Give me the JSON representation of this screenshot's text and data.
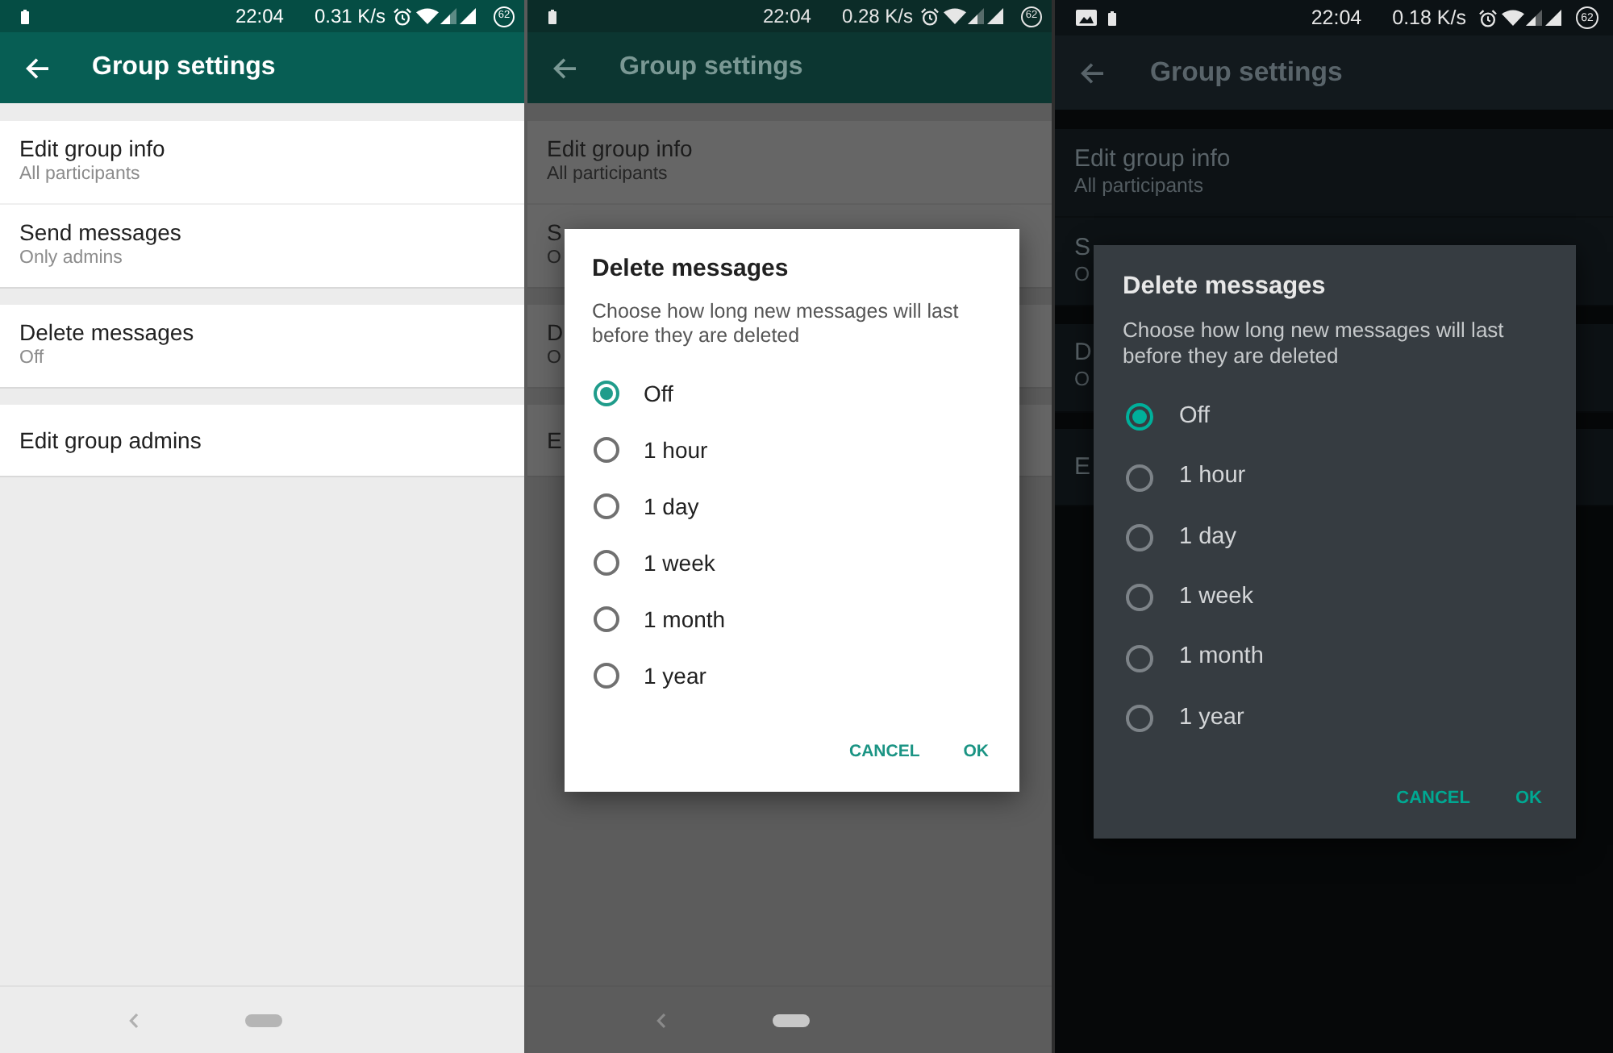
{
  "panels": [
    {
      "kind": "light",
      "status_bar": {
        "time": "22:04",
        "speed": "0.31 K/s",
        "battery": "62"
      },
      "app_bar": {
        "title": "Group settings"
      },
      "sections": [
        {
          "items": [
            {
              "title": "Edit group info",
              "subtitle": "All participants"
            },
            {
              "title": "Send messages",
              "subtitle": "Only admins"
            }
          ]
        },
        {
          "items": [
            {
              "title": "Delete messages",
              "subtitle": "Off"
            }
          ]
        },
        {
          "items": [
            {
              "title": "Edit group admins"
            }
          ]
        }
      ],
      "nav_bar": true
    },
    {
      "kind": "dimmed",
      "status_bar": {
        "time": "22:04",
        "speed": "0.28 K/s",
        "battery": "62"
      },
      "app_bar": {
        "title": "Group settings"
      },
      "sections": [
        {
          "items": [
            {
              "title": "Edit group info",
              "subtitle": "All participants"
            },
            {
              "title": "S",
              "subtitle": "O"
            }
          ]
        },
        {
          "items": [
            {
              "title": "D",
              "subtitle": "O"
            }
          ]
        },
        {
          "items": [
            {
              "title": "E"
            }
          ]
        }
      ],
      "nav_bar": true,
      "dialog": {
        "title": "Delete messages",
        "message": "Choose how long new messages will last before they are deleted",
        "options": [
          {
            "label": "Off",
            "selected": true
          },
          {
            "label": "1 hour",
            "selected": false
          },
          {
            "label": "1 day",
            "selected": false
          },
          {
            "label": "1 week",
            "selected": false
          },
          {
            "label": "1 month",
            "selected": false
          },
          {
            "label": "1 year",
            "selected": false
          }
        ],
        "buttons": [
          "CANCEL",
          "OK"
        ]
      }
    },
    {
      "kind": "dark",
      "status_bar": {
        "image_notification": true,
        "time": "22:04",
        "speed": "0.18 K/s",
        "battery": "62"
      },
      "app_bar": {
        "title": "Group settings"
      },
      "sections": [
        {
          "items": [
            {
              "title": "Edit group info",
              "subtitle": "All participants"
            },
            {
              "title": "S",
              "subtitle": "O"
            }
          ]
        },
        {
          "items": [
            {
              "title": "D",
              "subtitle": "O"
            }
          ]
        },
        {
          "items": [
            {
              "title": "E"
            }
          ]
        }
      ],
      "dialog": {
        "title": "Delete messages",
        "message": "Choose how long new messages will last before they are deleted",
        "options": [
          {
            "label": "Off",
            "selected": true
          },
          {
            "label": "1 hour",
            "selected": false
          },
          {
            "label": "1 day",
            "selected": false
          },
          {
            "label": "1 week",
            "selected": false
          },
          {
            "label": "1 month",
            "selected": false
          },
          {
            "label": "1 year",
            "selected": false
          }
        ],
        "buttons": [
          "CANCEL",
          "OK"
        ]
      }
    }
  ]
}
